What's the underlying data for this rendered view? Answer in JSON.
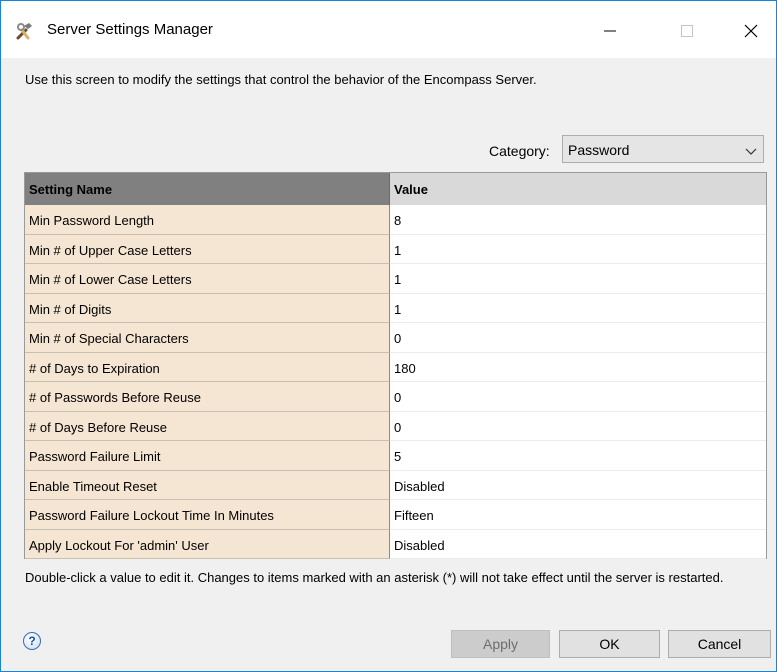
{
  "window": {
    "title": "Server Settings Manager"
  },
  "intro_text": "Use this screen to modify the settings that control the behavior of the Encompass Server.",
  "category": {
    "label": "Category:",
    "selected": "Password"
  },
  "table": {
    "headers": [
      "Setting Name",
      "Value"
    ],
    "rows": [
      {
        "name": "Min Password Length",
        "value": "8"
      },
      {
        "name": "Min # of Upper Case Letters",
        "value": "1"
      },
      {
        "name": "Min # of Lower Case Letters",
        "value": "1"
      },
      {
        "name": "Min # of Digits",
        "value": "1"
      },
      {
        "name": "Min # of Special Characters",
        "value": "0"
      },
      {
        "name": "# of Days to Expiration",
        "value": "180"
      },
      {
        "name": "# of Passwords Before Reuse",
        "value": "0"
      },
      {
        "name": "# of Days Before Reuse",
        "value": "0"
      },
      {
        "name": "Password Failure Limit",
        "value": "5"
      },
      {
        "name": "Enable Timeout Reset",
        "value": "Disabled"
      },
      {
        "name": "Password Failure Lockout Time In Minutes",
        "value": "Fifteen"
      },
      {
        "name": "Apply Lockout For 'admin' User",
        "value": "Disabled"
      }
    ]
  },
  "footer_note": "Double-click a value to edit it. Changes to items marked with an asterisk (*) will not take effect until the server is restarted.",
  "buttons": {
    "apply": "Apply",
    "ok": "OK",
    "cancel": "Cancel"
  },
  "icons": {
    "app": "tools-icon",
    "help": "help-icon"
  }
}
